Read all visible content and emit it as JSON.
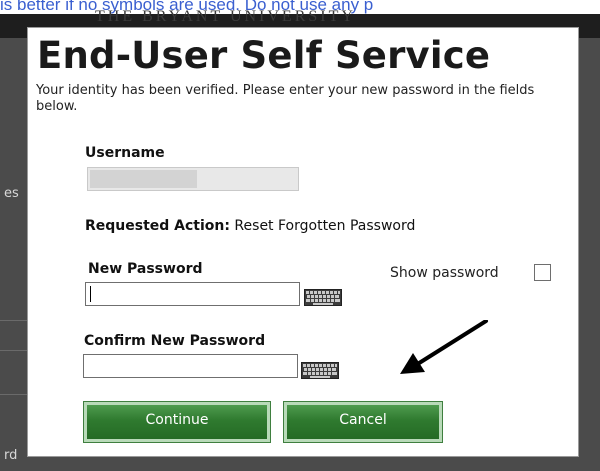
{
  "background": {
    "top_text": "is better if no symbols are used. Do not use any p",
    "banner_text": "THE BRYANT UNIVERSITY",
    "left_fragments": [
      "es",
      "rd"
    ]
  },
  "dialog": {
    "title": "End-User Self Service",
    "description": "Your identity has been verified. Please enter your new password in the fields below.",
    "username_label": "Username",
    "username_value": "",
    "requested_action_label": "Requested Action:",
    "requested_action_value": " Reset Forgotten Password",
    "new_password_label": "New Password",
    "new_password_value": "",
    "show_password_label": "Show password",
    "show_password_checked": false,
    "confirm_password_label": "Confirm New Password",
    "confirm_password_value": "",
    "continue_label": "Continue",
    "cancel_label": "Cancel"
  },
  "icons": {
    "keyboard": "keyboard-icon",
    "arrow": "arrow-annotation-icon"
  },
  "colors": {
    "button_green": "#2f7a2f",
    "overlay": "#4b4b4b",
    "link_blue": "#3a5fd0"
  }
}
